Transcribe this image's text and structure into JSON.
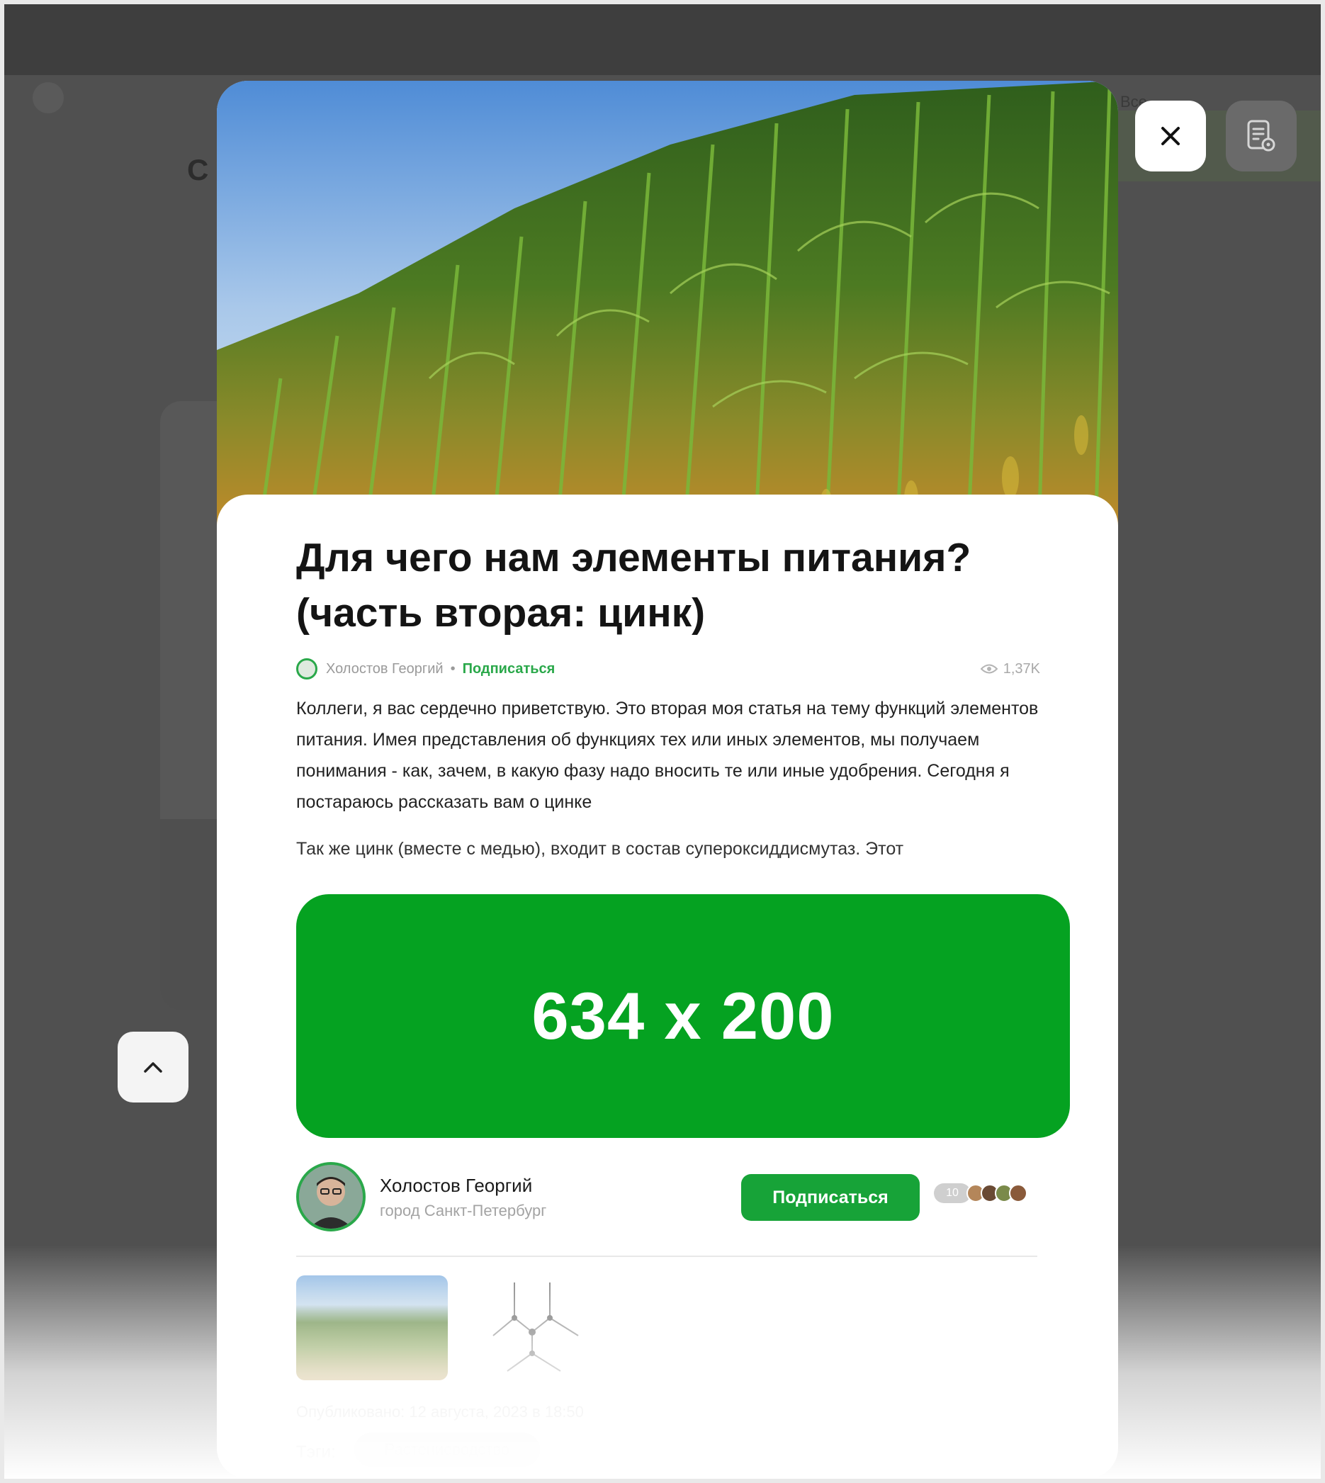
{
  "background": {
    "title_fragment": "С",
    "right_text": "Все...",
    "colors": {
      "overlay": "#4a4a4a"
    }
  },
  "controls": {
    "close_icon": "close-icon",
    "reader_icon": "reader-mode-icon",
    "scroll_up_icon": "chevron-up-icon"
  },
  "article": {
    "title": "Для чего нам элементы питания? (часть вторая: цинк)",
    "meta": {
      "author": "Холостов Георгий",
      "separator": "•",
      "subscribe_link": "Подписаться",
      "views": "1,37K"
    },
    "lead": "Коллеги, я вас сердечно приветствую. Это вторая моя статья на тему функций элементов питания. Имея представления об функциях тех или иных элементов, мы получаем понимания - как, зачем, в какую фазу надо вносить те или иные удобрения. Сегодня я постараюсь рассказать вам о цинке",
    "paragraph2": "Так же цинк (вместе с медью), входит в состав супероксиддисмутаз. Этот",
    "ad_label": "634 x 200",
    "author_card": {
      "name": "Холостов Георгий",
      "city": "город Санкт-Петербург",
      "subscribe_button": "Подписаться",
      "subscribers_count": "10"
    },
    "published": "Опубликовано: 12 августа, 2023 в 18:50",
    "tags_label": "Тэги:",
    "tag": "Растениеводство"
  },
  "colors": {
    "accent": "#17a338",
    "ad_background": "#05a221"
  }
}
